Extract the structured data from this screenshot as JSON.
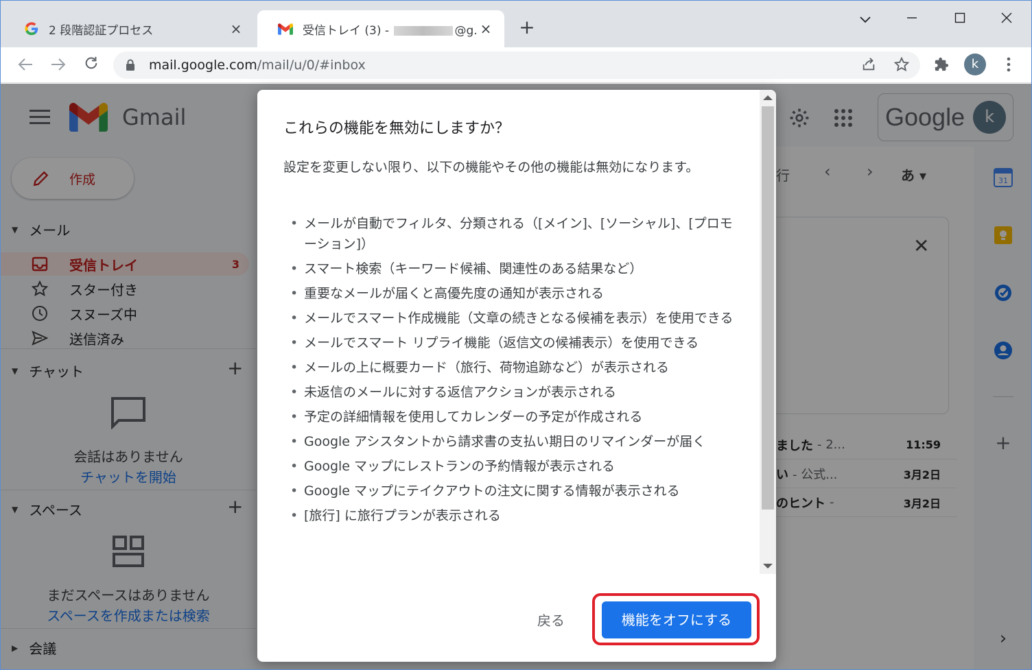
{
  "browser": {
    "tabs": [
      {
        "title": "2 段階認証プロセス",
        "icon": "google-g-icon",
        "active": false
      },
      {
        "title_prefix": "受信トレイ (3) - ",
        "title_suffix": "@g.u-f",
        "icon": "gmail-icon",
        "active": true
      }
    ],
    "close_glyph": "×",
    "new_tab_glyph": "+",
    "url_host": "mail.google.com",
    "url_path": "/mail/u/0/#inbox",
    "profile_initial": "k"
  },
  "gmail": {
    "brand": "Gmail",
    "compose_label": "作成",
    "mail_section": "メール",
    "nav_items": [
      {
        "label": "受信トレイ",
        "count": "3",
        "icon": "inbox-icon"
      },
      {
        "label": "スター付き",
        "icon": "star-icon"
      },
      {
        "label": "スヌーズ中",
        "icon": "clock-icon"
      },
      {
        "label": "送信済み",
        "icon": "send-icon"
      }
    ],
    "chat_section": "チャット",
    "chat_empty": "会話はありません",
    "chat_start": "チャットを開始",
    "spaces_section": "スペース",
    "spaces_empty": "まだスペースはありません",
    "spaces_create": "スペースを作成または検索",
    "meet_section": "会議",
    "google_word": "Google",
    "account_initial": "k",
    "pager_text": "行",
    "lang_label": "あ",
    "mail_rows": [
      {
        "subject": "ました",
        "snippet": "- 2...",
        "time": "11:59"
      },
      {
        "subject": "い",
        "snippet": "- 公式...",
        "time": "3月2日"
      },
      {
        "subject": "のヒント",
        "snippet": "- ",
        "time": "3月2日"
      }
    ]
  },
  "dialog": {
    "title": "これらの機能を無効にしますか？",
    "intro": "設定を変更しない限り、以下の機能やその他の機能は無効になります。",
    "items": [
      "メールが自動でフィルタ、分類される（[メイン]、[ソーシャル]、[プロモーション]）",
      "スマート検索（キーワード候補、関連性のある結果など）",
      "重要なメールが届くと高優先度の通知が表示される",
      "メールでスマート作成機能（文章の続きとなる候補を表示）を使用できる",
      "メールでスマート リプライ機能（返信文の候補表示）を使用できる",
      "メールの上に概要カード（旅行、荷物追跡など）が表示される",
      "未返信のメールに対する返信アクションが表示される",
      "予定の詳細情報を使用してカレンダーの予定が作成される",
      "Google アシスタントから請求書の支払い期日のリマインダーが届く",
      "Google マップにレストランの予約情報が表示される",
      "Google マップにテイクアウトの注文に関する情報が表示される",
      "[旅行] に旅行プランが表示される"
    ],
    "back_label": "戻る",
    "confirm_label": "機能をオフにする"
  },
  "colors": {
    "accent": "#1a73e8",
    "highlight": "#e0202a",
    "inbox_active": "#c5221f"
  }
}
